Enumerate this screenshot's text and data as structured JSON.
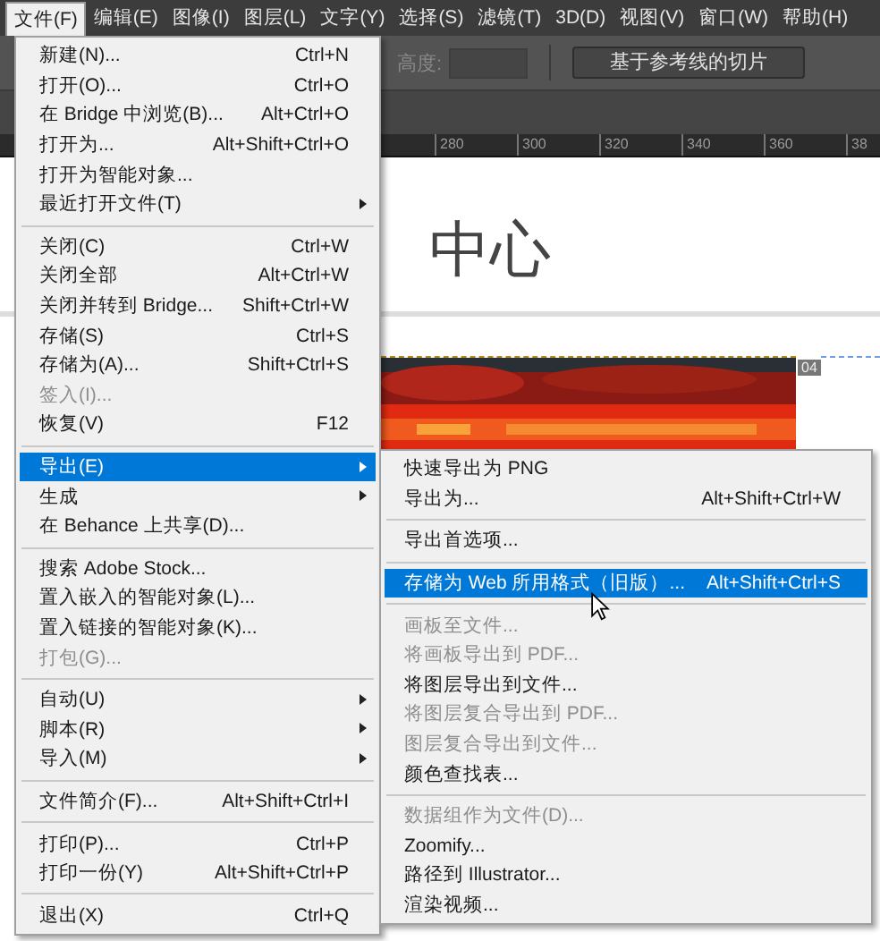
{
  "menubar": [
    {
      "label": "文件(F)",
      "selected": true
    },
    {
      "label": "编辑(E)",
      "selected": false
    },
    {
      "label": "图像(I)",
      "selected": false
    },
    {
      "label": "图层(L)",
      "selected": false
    },
    {
      "label": "文字(Y)",
      "selected": false
    },
    {
      "label": "选择(S)",
      "selected": false
    },
    {
      "label": "滤镜(T)",
      "selected": false
    },
    {
      "label": "3D(D)",
      "selected": false
    },
    {
      "label": "视图(V)",
      "selected": false
    },
    {
      "label": "窗口(W)",
      "selected": false
    },
    {
      "label": "帮助(H)",
      "selected": false
    }
  ],
  "options_bar": {
    "height_label": "高度:",
    "button": "基于参考线的切片"
  },
  "ruler": [
    "280",
    "300",
    "320",
    "340",
    "360",
    "38"
  ],
  "canvas": {
    "heading": "中心",
    "slice_badge": "04"
  },
  "file_menu": [
    {
      "kind": "item",
      "label": "新建(N)...",
      "shortcut": "Ctrl+N",
      "disabled": false,
      "submenu": false,
      "selected": false
    },
    {
      "kind": "item",
      "label": "打开(O)...",
      "shortcut": "Ctrl+O",
      "disabled": false,
      "submenu": false,
      "selected": false
    },
    {
      "kind": "item",
      "label": "在 Bridge 中浏览(B)...",
      "shortcut": "Alt+Ctrl+O",
      "disabled": false,
      "submenu": false,
      "selected": false
    },
    {
      "kind": "item",
      "label": "打开为...",
      "shortcut": "Alt+Shift+Ctrl+O",
      "disabled": false,
      "submenu": false,
      "selected": false
    },
    {
      "kind": "item",
      "label": "打开为智能对象...",
      "disabled": false,
      "submenu": false,
      "selected": false
    },
    {
      "kind": "item",
      "label": "最近打开文件(T)",
      "disabled": false,
      "submenu": true,
      "selected": false
    },
    {
      "kind": "separator"
    },
    {
      "kind": "item",
      "label": "关闭(C)",
      "shortcut": "Ctrl+W",
      "disabled": false,
      "submenu": false,
      "selected": false
    },
    {
      "kind": "item",
      "label": "关闭全部",
      "shortcut": "Alt+Ctrl+W",
      "disabled": false,
      "submenu": false,
      "selected": false
    },
    {
      "kind": "item",
      "label": "关闭并转到 Bridge...",
      "shortcut": "Shift+Ctrl+W",
      "disabled": false,
      "submenu": false,
      "selected": false
    },
    {
      "kind": "item",
      "label": "存储(S)",
      "shortcut": "Ctrl+S",
      "disabled": false,
      "submenu": false,
      "selected": false
    },
    {
      "kind": "item",
      "label": "存储为(A)...",
      "shortcut": "Shift+Ctrl+S",
      "disabled": false,
      "submenu": false,
      "selected": false
    },
    {
      "kind": "item",
      "label": "签入(I)...",
      "disabled": true,
      "submenu": false,
      "selected": false
    },
    {
      "kind": "item",
      "label": "恢复(V)",
      "shortcut": "F12",
      "disabled": false,
      "submenu": false,
      "selected": false
    },
    {
      "kind": "separator"
    },
    {
      "kind": "item",
      "label": "导出(E)",
      "disabled": false,
      "submenu": true,
      "selected": true
    },
    {
      "kind": "item",
      "label": "生成",
      "disabled": false,
      "submenu": true,
      "selected": false
    },
    {
      "kind": "item",
      "label": "在 Behance 上共享(D)...",
      "disabled": false,
      "submenu": false,
      "selected": false
    },
    {
      "kind": "separator"
    },
    {
      "kind": "item",
      "label": "搜索 Adobe Stock...",
      "disabled": false,
      "submenu": false,
      "selected": false
    },
    {
      "kind": "item",
      "label": "置入嵌入的智能对象(L)...",
      "disabled": false,
      "submenu": false,
      "selected": false
    },
    {
      "kind": "item",
      "label": "置入链接的智能对象(K)...",
      "disabled": false,
      "submenu": false,
      "selected": false
    },
    {
      "kind": "item",
      "label": "打包(G)...",
      "disabled": true,
      "submenu": false,
      "selected": false
    },
    {
      "kind": "separator"
    },
    {
      "kind": "item",
      "label": "自动(U)",
      "disabled": false,
      "submenu": true,
      "selected": false
    },
    {
      "kind": "item",
      "label": "脚本(R)",
      "disabled": false,
      "submenu": true,
      "selected": false
    },
    {
      "kind": "item",
      "label": "导入(M)",
      "disabled": false,
      "submenu": true,
      "selected": false
    },
    {
      "kind": "separator"
    },
    {
      "kind": "item",
      "label": "文件简介(F)...",
      "shortcut": "Alt+Shift+Ctrl+I",
      "disabled": false,
      "submenu": false,
      "selected": false
    },
    {
      "kind": "separator"
    },
    {
      "kind": "item",
      "label": "打印(P)...",
      "shortcut": "Ctrl+P",
      "disabled": false,
      "submenu": false,
      "selected": false
    },
    {
      "kind": "item",
      "label": "打印一份(Y)",
      "shortcut": "Alt+Shift+Ctrl+P",
      "disabled": false,
      "submenu": false,
      "selected": false
    },
    {
      "kind": "separator"
    },
    {
      "kind": "item",
      "label": "退出(X)",
      "shortcut": "Ctrl+Q",
      "disabled": false,
      "submenu": false,
      "selected": false
    }
  ],
  "export_submenu": [
    {
      "kind": "item",
      "label": "快速导出为 PNG",
      "disabled": false,
      "submenu": false,
      "selected": false
    },
    {
      "kind": "item",
      "label": "导出为...",
      "shortcut": "Alt+Shift+Ctrl+W",
      "disabled": false,
      "submenu": false,
      "selected": false
    },
    {
      "kind": "separator"
    },
    {
      "kind": "item",
      "label": "导出首选项...",
      "disabled": false,
      "submenu": false,
      "selected": false
    },
    {
      "kind": "separator"
    },
    {
      "kind": "item",
      "label": "存储为 Web 所用格式（旧版）...",
      "shortcut": "Alt+Shift+Ctrl+S",
      "disabled": false,
      "submenu": false,
      "selected": true
    },
    {
      "kind": "separator"
    },
    {
      "kind": "item",
      "label": "画板至文件...",
      "disabled": true,
      "submenu": false,
      "selected": false
    },
    {
      "kind": "item",
      "label": "将画板导出到 PDF...",
      "disabled": true,
      "submenu": false,
      "selected": false
    },
    {
      "kind": "item",
      "label": "将图层导出到文件...",
      "disabled": false,
      "submenu": false,
      "selected": false
    },
    {
      "kind": "item",
      "label": "将图层复合导出到 PDF...",
      "disabled": true,
      "submenu": false,
      "selected": false
    },
    {
      "kind": "item",
      "label": "图层复合导出到文件...",
      "disabled": true,
      "submenu": false,
      "selected": false
    },
    {
      "kind": "item",
      "label": "颜色查找表...",
      "disabled": false,
      "submenu": false,
      "selected": false
    },
    {
      "kind": "separator"
    },
    {
      "kind": "item",
      "label": "数据组作为文件(D)...",
      "disabled": true,
      "submenu": false,
      "selected": false
    },
    {
      "kind": "item",
      "label": "Zoomify...",
      "disabled": false,
      "submenu": false,
      "selected": false
    },
    {
      "kind": "item",
      "label": "路径到 Illustrator...",
      "disabled": false,
      "submenu": false,
      "selected": false
    },
    {
      "kind": "item",
      "label": "渲染视频...",
      "disabled": false,
      "submenu": false,
      "selected": false
    }
  ]
}
